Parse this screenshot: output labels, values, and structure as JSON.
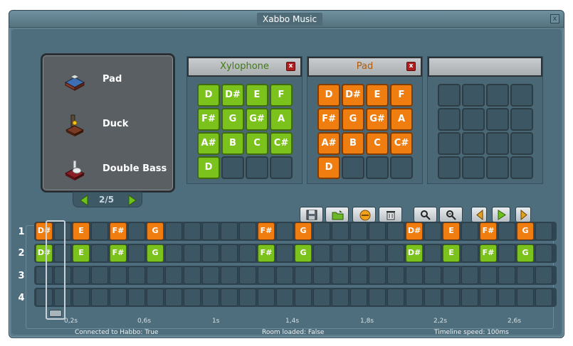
{
  "window": {
    "title": "Xabbo Music",
    "close_glyph": "x"
  },
  "furni_list": {
    "items": [
      {
        "label": "Pad",
        "icon": "pad-furni-icon"
      },
      {
        "label": "Duck",
        "icon": "duck-furni-icon"
      },
      {
        "label": "Double Bass",
        "icon": "double-bass-furni-icon"
      }
    ],
    "page_indicator": "2/5"
  },
  "instruments": [
    {
      "name": "Xylophone",
      "name_color": "#3f7a12",
      "color": "green",
      "close_glyph": "x",
      "keys": [
        "D",
        "D#",
        "E",
        "F",
        "F#",
        "G",
        "G#",
        "A",
        "A#",
        "B",
        "C",
        "C#",
        "D",
        "",
        "",
        ""
      ]
    },
    {
      "name": "Pad",
      "name_color": "#b35a08",
      "color": "orange",
      "close_glyph": "x",
      "keys": [
        "D",
        "D#",
        "E",
        "F",
        "F#",
        "G",
        "G#",
        "A",
        "A#",
        "B",
        "C",
        "C#",
        "D",
        "",
        "",
        ""
      ]
    },
    {
      "name": "",
      "color": "empty",
      "keys": [
        "",
        "",
        "",
        "",
        "",
        "",
        "",
        "",
        "",
        "",
        "",
        "",
        "",
        "",
        "",
        ""
      ]
    }
  ],
  "toolbar": {
    "buttons": [
      "save-icon",
      "open-folder-icon",
      "clear-icon",
      "delete-icon",
      "zoom-out-icon",
      "zoom-in-icon",
      "previous-icon",
      "play-icon",
      "next-icon"
    ]
  },
  "timeline": {
    "rows": [
      {
        "label": "1",
        "color": "orange",
        "notes": {
          "0": "D#",
          "2": "E",
          "4": "F#",
          "6": "G",
          "12": "F#",
          "14": "G",
          "20": "D#",
          "22": "E",
          "24": "F#",
          "26": "G"
        }
      },
      {
        "label": "2",
        "color": "green",
        "notes": {
          "0": "D#",
          "2": "E",
          "4": "F#",
          "6": "G",
          "12": "F#",
          "14": "G",
          "20": "D#",
          "22": "E",
          "24": "F#",
          "26": "G"
        }
      },
      {
        "label": "3",
        "color": "",
        "notes": {}
      },
      {
        "label": "4",
        "color": "",
        "notes": {}
      }
    ],
    "slots": 28,
    "ticks": [
      "0,2s",
      "0,6s",
      "1s",
      "1,4s",
      "1,8s",
      "2,2s",
      "2,6s"
    ]
  },
  "status": {
    "connected": "Connected to Habbo: True",
    "room_loaded": "Room loaded: False",
    "timeline_speed": "Timeline speed: 100ms"
  }
}
